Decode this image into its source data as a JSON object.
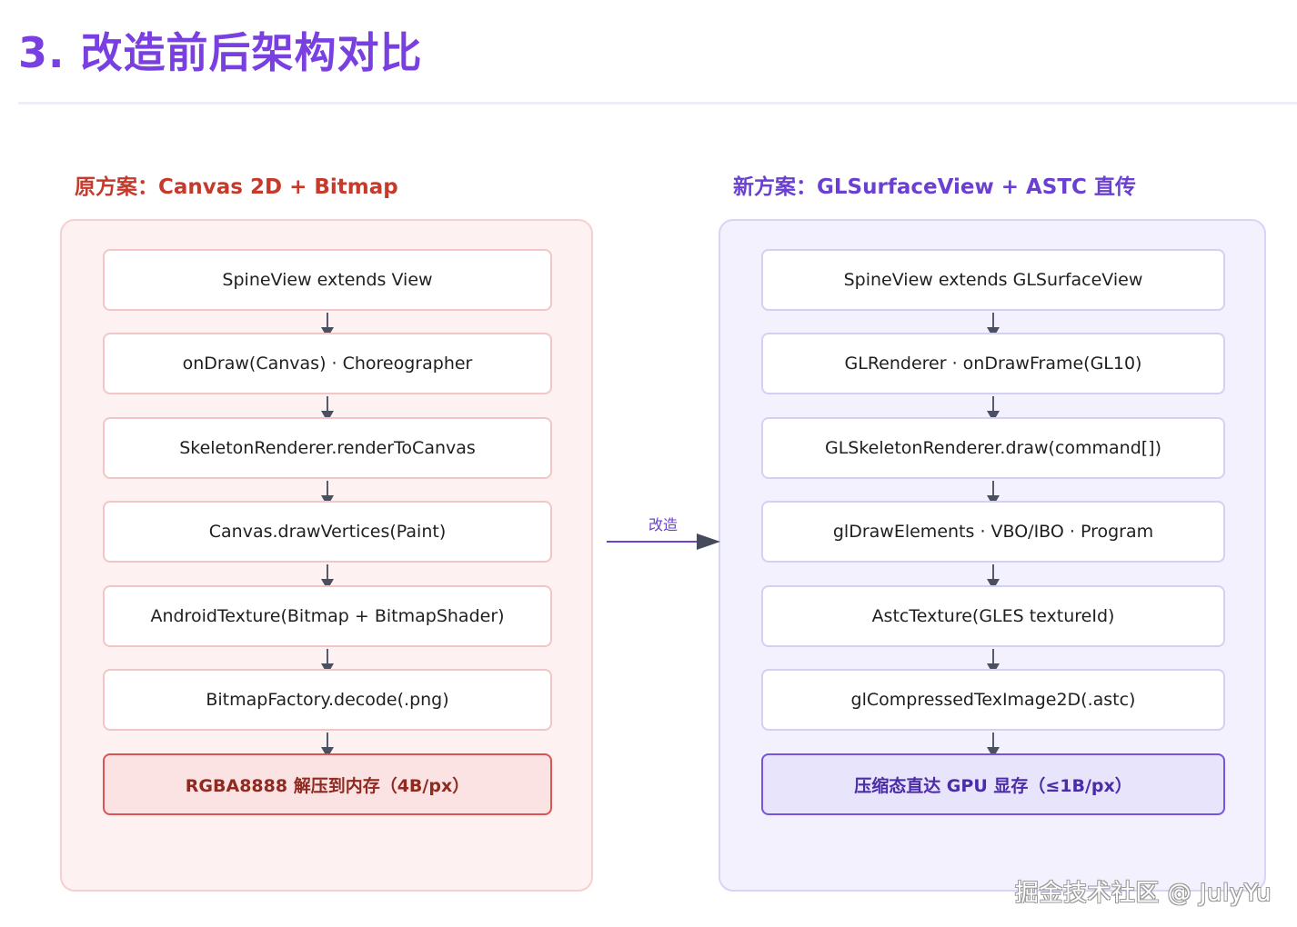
{
  "title": "3. 改造前后架构对比",
  "left": {
    "heading": "原方案：Canvas 2D + Bitmap",
    "nodes": [
      "SpineView extends View",
      "onDraw(Canvas) · Choreographer",
      "SkeletonRenderer.renderToCanvas",
      "Canvas.drawVertices(Paint)",
      "AndroidTexture(Bitmap + BitmapShader)",
      "BitmapFactory.decode(.png)",
      "RGBA8888 解压到内存（4B/px）"
    ]
  },
  "right": {
    "heading": "新方案：GLSurfaceView + ASTC 直传",
    "nodes": [
      "SpineView extends GLSurfaceView",
      "GLRenderer · onDrawFrame(GL10)",
      "GLSkeletonRenderer.draw(command[])",
      "glDrawElements · VBO/IBO · Program",
      "AstcTexture(GLES textureId)",
      "glCompressedTexImage2D(.astc)",
      "压缩态直达 GPU 显存（≤1B/px）"
    ]
  },
  "transition_label": "改造",
  "watermark": "掘金技术社区 @ JulyYu",
  "colors": {
    "title": "#7a3fe0",
    "left_accent": "#c63a2c",
    "right_accent": "#6a3fd2"
  }
}
